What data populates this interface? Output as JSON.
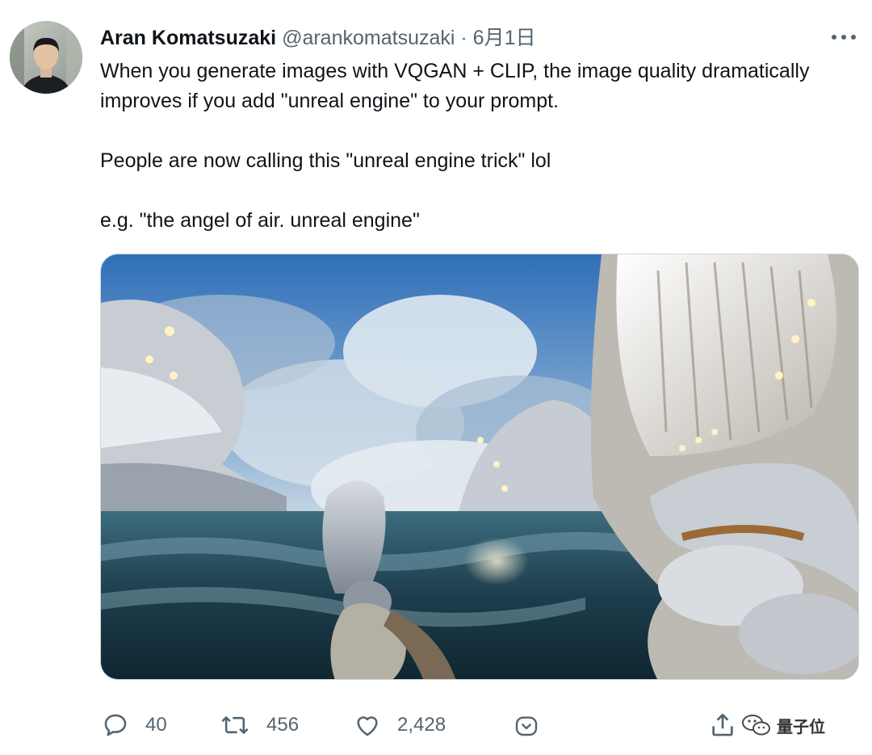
{
  "tweet": {
    "author_name": "Aran Komatsuzaki",
    "handle": "@arankomatsuzaki",
    "separator": "·",
    "date": "6月1日",
    "lines": [
      "When you generate images with VQGAN + CLIP, the image quality dramatically improves if you add \"unreal engine\" to your prompt.",
      "People are now calling this \"unreal engine trick\" lol",
      "e.g. \"the angel of air. unreal engine\""
    ]
  },
  "actions": {
    "reply_count": "40",
    "retweet_count": "456",
    "like_count": "2,428"
  },
  "watermark": {
    "text": "量子位"
  },
  "icons": {
    "more": "more-horizontal-icon",
    "reply": "speech-bubble-icon",
    "retweet": "retweet-arrows-icon",
    "like": "heart-icon",
    "tip": "chevron-badge-icon",
    "share": "share-upload-icon",
    "watermark": "wechat-logo-icon"
  },
  "colors": {
    "text": "#0f1419",
    "secondary": "#536471"
  }
}
